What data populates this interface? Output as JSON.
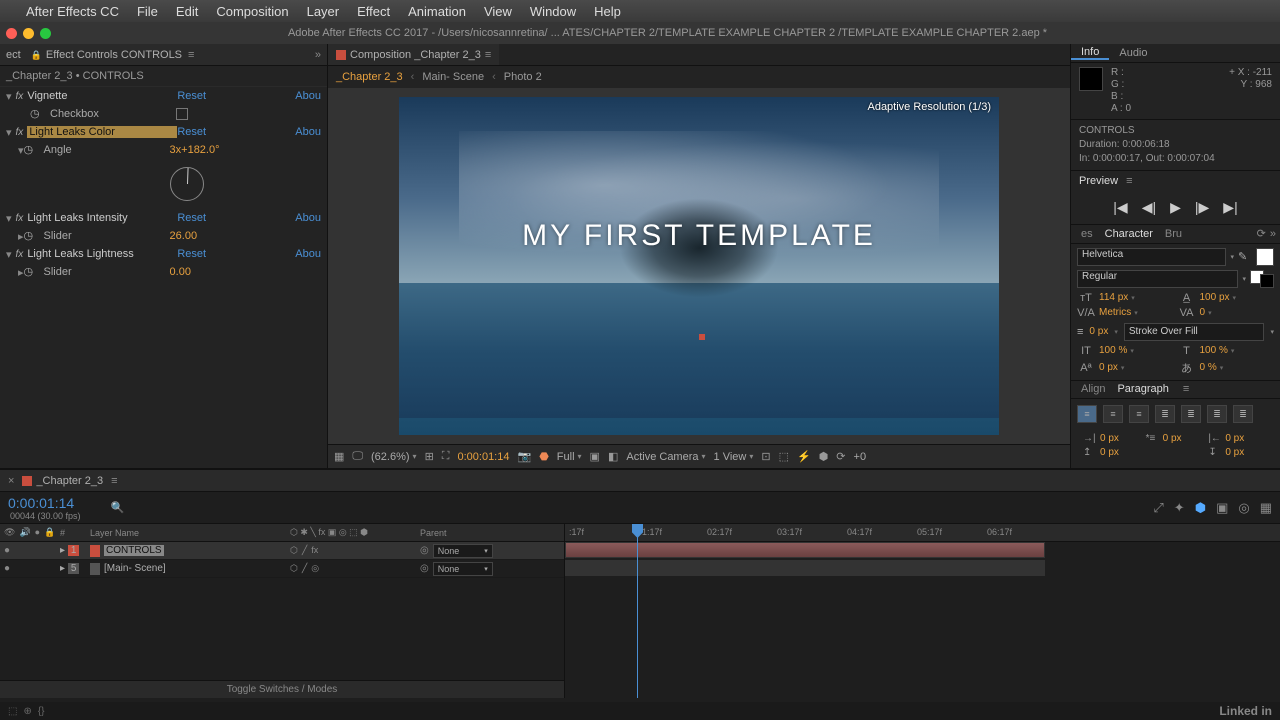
{
  "menubar": {
    "app": "After Effects CC",
    "items": [
      "File",
      "Edit",
      "Composition",
      "Layer",
      "Effect",
      "Animation",
      "View",
      "Window",
      "Help"
    ]
  },
  "titlebar": "Adobe After Effects CC 2017 - /Users/nicosannretina/ ... ATES/CHAPTER 2/TEMPLATE EXAMPLE CHAPTER 2 /TEMPLATE EXAMPLE CHAPTER 2.aep *",
  "effectPanel": {
    "tabPrefix": "ect",
    "tabTitle": "Effect Controls CONTROLS",
    "subhead": "_Chapter 2_3 • CONTROLS",
    "effects": [
      {
        "name": "Vignette",
        "reset": "Reset",
        "about": "Abou",
        "props": [
          {
            "name": "Checkbox",
            "type": "box"
          }
        ]
      },
      {
        "name": "Light Leaks Color",
        "reset": "Reset",
        "about": "Abou",
        "selected": true,
        "props": [
          {
            "name": "Angle",
            "value": "3x+182.0°",
            "dial": true
          }
        ]
      },
      {
        "name": "Light Leaks Intensity",
        "reset": "Reset",
        "about": "Abou",
        "props": [
          {
            "name": "Slider",
            "value": "26.00"
          }
        ]
      },
      {
        "name": "Light Leaks Lightness",
        "reset": "Reset",
        "about": "Abou",
        "props": [
          {
            "name": "Slider",
            "value": "0.00"
          }
        ]
      }
    ]
  },
  "compPanel": {
    "tabTitle": "Composition _Chapter 2_3",
    "breadcrumb": [
      "_Chapter 2_3",
      "Main- Scene",
      "Photo 2"
    ],
    "frameText": "MY FIRST TEMPLATE",
    "adaptive": "Adaptive Resolution (1/3)",
    "viewer": {
      "zoom": "(62.6%)",
      "time": "0:00:01:14",
      "res": "Full",
      "camera": "Active Camera",
      "views": "1 View",
      "plus": "+0"
    }
  },
  "info": {
    "tabs": [
      "Info",
      "Audio"
    ],
    "rgba": {
      "r": "R :",
      "g": "G :",
      "b": "B :",
      "a": "A : 0"
    },
    "xy": {
      "x": "X : -211",
      "y": "Y :  968",
      "cross": "+"
    },
    "ctrl": {
      "name": "CONTROLS",
      "dur": "Duration: 0:00:06:18",
      "io": "In: 0:00:00:17, Out: 0:00:07:04"
    }
  },
  "preview": {
    "title": "Preview"
  },
  "character": {
    "tabs": [
      "es",
      "Character",
      "Bru"
    ],
    "font": "Helvetica",
    "weight": "Regular",
    "size": "114 px",
    "leading": "100 px",
    "kerning": "Metrics",
    "tracking": "0",
    "strokeWidth": "0 px",
    "strokeOrder": "Stroke Over Fill",
    "vscale": "100 %",
    "hscale": "100 %",
    "baseline": "0 px",
    "tsume": "0 %"
  },
  "alignPara": {
    "tabs": [
      "Align",
      "Paragraph"
    ],
    "indentL": "0 px",
    "indentR": "0 px",
    "indentF": "0 px",
    "spaceBefore": "0 px",
    "spaceAfter": "0 px"
  },
  "timeline": {
    "tab": "_Chapter 2_3",
    "time": "0:00:01:14",
    "sub": "00044 (30.00 fps)",
    "cols": {
      "name": "Layer Name",
      "parent": "Parent"
    },
    "ticks": [
      ":17f",
      "01:17f",
      "02:17f",
      "03:17f",
      "04:17f",
      "05:17f",
      "06:17f"
    ],
    "layers": [
      {
        "num": "1",
        "name": "CONTROLS",
        "parent": "None",
        "color": "r"
      },
      {
        "num": "5",
        "name": "[Main- Scene]",
        "parent": "None",
        "color": "g"
      }
    ],
    "toggle": "Toggle Switches / Modes"
  },
  "footer": {
    "linkedin": "Linked in"
  }
}
